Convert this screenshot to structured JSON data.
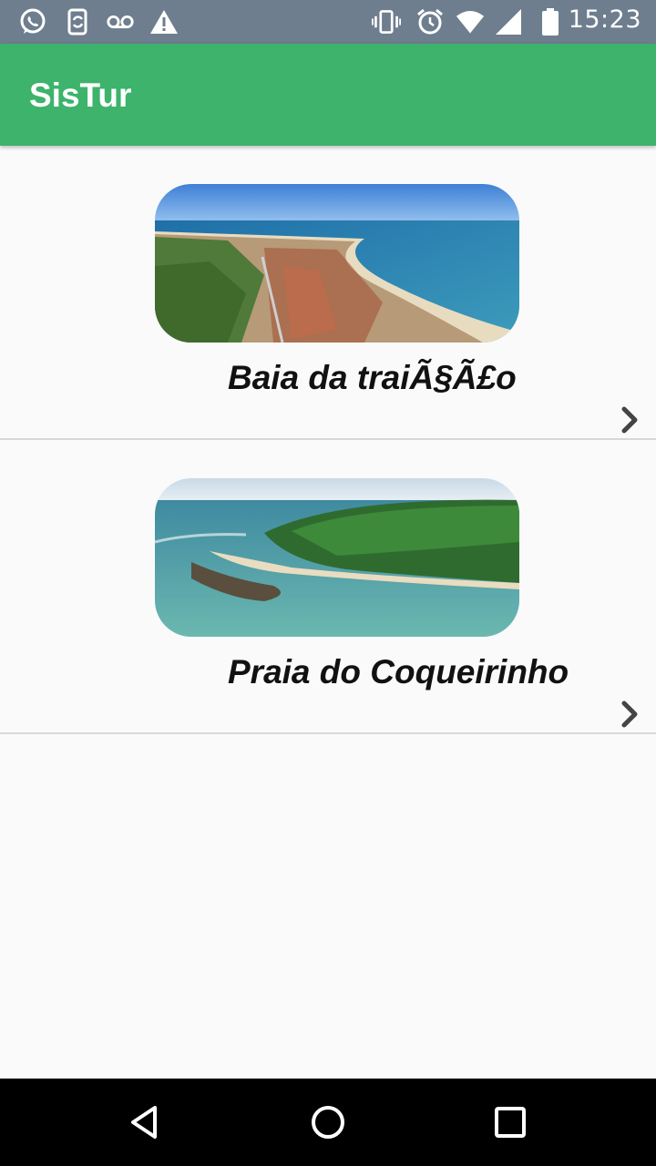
{
  "status_bar": {
    "time": "15:23",
    "left_icons": [
      "whatsapp-icon",
      "phone-sync-icon",
      "voicemail-icon",
      "warning-icon"
    ],
    "right_icons": [
      "vibrate-icon",
      "alarm-icon",
      "wifi-icon",
      "signal-icon",
      "battery-icon"
    ]
  },
  "app_bar": {
    "title": "SisTur"
  },
  "places": [
    {
      "title": "Baia da traiÃ§Ã£o",
      "image": "aerial coastal town photo"
    },
    {
      "title": "Praia do Coqueirinho",
      "image": "beach with palm trees photo"
    }
  ],
  "nav_bar": {
    "buttons": [
      "back-icon",
      "home-icon",
      "recents-icon"
    ]
  }
}
